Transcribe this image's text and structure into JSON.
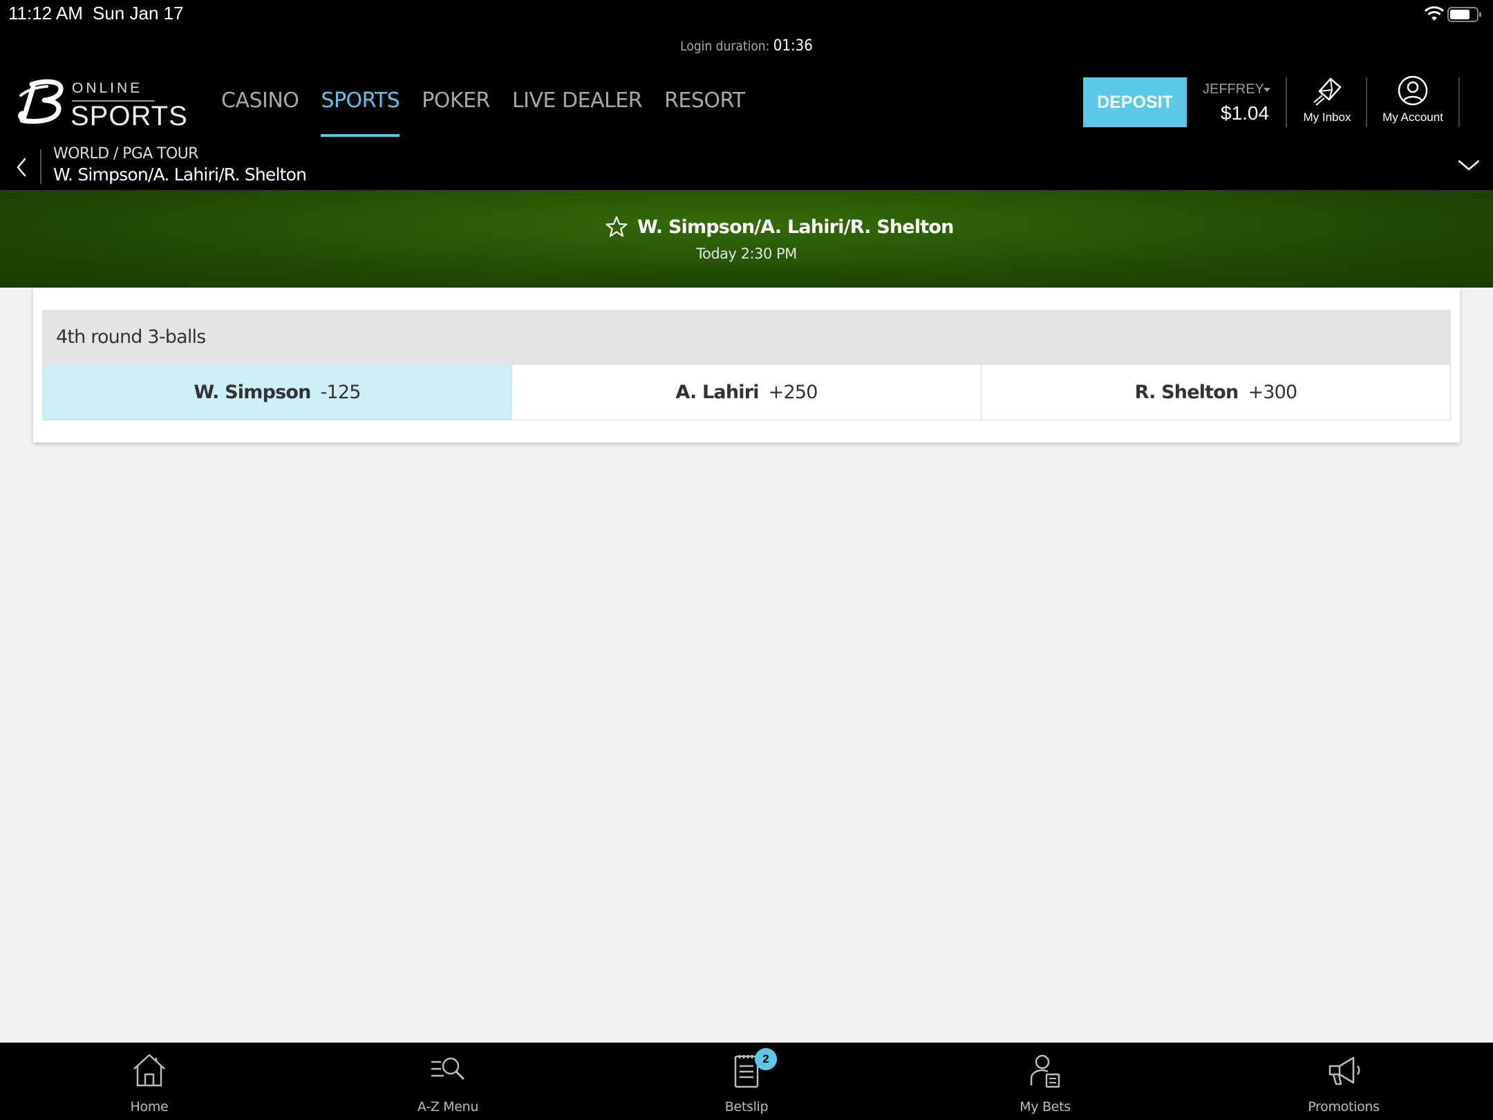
{
  "status_bar": {
    "time": "11:12 AM",
    "date": "Sun Jan 17"
  },
  "header": {
    "login_label": "Login duration: ",
    "login_value": "01:36",
    "logo": {
      "line1": "ONLINE",
      "line2": "SPORTS"
    },
    "nav": [
      {
        "label": "CASINO",
        "active": false
      },
      {
        "label": "SPORTS",
        "active": true
      },
      {
        "label": "POKER",
        "active": false
      },
      {
        "label": "LIVE DEALER",
        "active": false
      },
      {
        "label": "RESORT",
        "active": false
      }
    ],
    "deposit_label": "DEPOSIT",
    "user_name": "JEFFREY",
    "balance": "$1.04",
    "inbox_label": "My Inbox",
    "account_label": "My Account",
    "accent_color": "#5bc8e8"
  },
  "breadcrumb": {
    "path": "WORLD / PGA TOUR",
    "title": "W. Simpson/A. Lahiri/R. Shelton"
  },
  "event": {
    "title": "W. Simpson/A. Lahiri/R. Shelton",
    "time": "Today 2:30 PM"
  },
  "market": {
    "title": "4th round 3-balls",
    "outcomes": [
      {
        "name": "W. Simpson",
        "odds": "-125",
        "selected": true
      },
      {
        "name": "A. Lahiri",
        "odds": "+250",
        "selected": false
      },
      {
        "name": "R. Shelton",
        "odds": "+300",
        "selected": false
      }
    ]
  },
  "bottom_nav": [
    {
      "label": "Home",
      "icon": "home-icon"
    },
    {
      "label": "A-Z Menu",
      "icon": "az-menu-icon"
    },
    {
      "label": "Betslip",
      "icon": "betslip-icon",
      "badge": "2"
    },
    {
      "label": "My Bets",
      "icon": "my-bets-icon"
    },
    {
      "label": "Promotions",
      "icon": "megaphone-icon"
    }
  ]
}
